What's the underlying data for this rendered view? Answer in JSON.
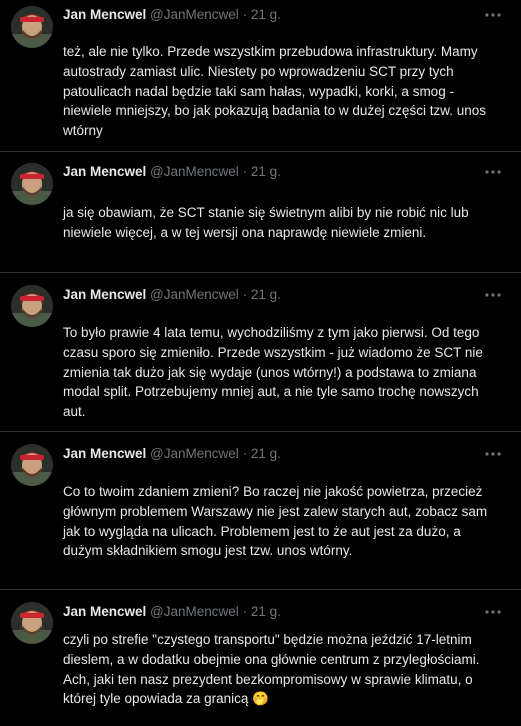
{
  "colors": {
    "background": "#000000",
    "text": "#e7e9ea",
    "muted": "#71767b",
    "divider": "#2f3336"
  },
  "icons": {
    "more": "more-horizontal-icon",
    "avatar": "profile-avatar"
  },
  "tweets": [
    {
      "name": "Jan Mencwel",
      "handle": "@JanMencwel",
      "separator": "·",
      "time": "21 g.",
      "text": "też, ale nie tylko. Przede wszystkim przebudowa infrastruktury. Mamy autostrady zamiast ulic. Niestety po wprowadzeniu SCT przy tych patoulicach nadal będzie taki sam hałas, wypadki, korki, a smog - niewiele mniejszy, bo jak pokazują badania to w dużej części tzw. unos wtórny"
    },
    {
      "name": "Jan Mencwel",
      "handle": "@JanMencwel",
      "separator": "·",
      "time": "21 g.",
      "text": "ja się obawiam, że SCT stanie się świetnym alibi by nie robić nic lub niewiele więcej, a w tej wersji ona naprawdę niewiele zmieni."
    },
    {
      "name": "Jan Mencwel",
      "handle": "@JanMencwel",
      "separator": "·",
      "time": "21 g.",
      "text": "To było prawie 4 lata temu, wychodziliśmy z tym jako pierwsi. Od tego czasu sporo się zmieniło. Przede wszystkim - już wiadomo że SCT nie zmienia tak dużo jak się wydaje (unos wtórny!) a podstawa to zmiana modal split. Potrzebujemy mniej aut, a nie tyle samo trochę nowszych aut."
    },
    {
      "name": "Jan Mencwel",
      "handle": "@JanMencwel",
      "separator": "·",
      "time": "21 g.",
      "text": "Co to twoim zdaniem zmieni? Bo raczej nie jakość powietrza, przecież głównym problemem Warszawy nie jest zalew starych aut, zobacz sam jak to wygląda na ulicach. Problemem jest to że aut jest za dużo, a dużym składnikiem smogu jest tzw. unos wtórny."
    },
    {
      "name": "Jan Mencwel",
      "handle": "@JanMencwel",
      "separator": "·",
      "time": "21 g.",
      "text": "czyli po strefie \"czystego transportu\" będzie można jeździć 17-letnim dieslem, a w dodatku obejmie ona głównie centrum z przyległościami. Ach, jaki ten nasz prezydent bezkompromisowy w sprawie klimatu, o której tyle opowiada za granicą 🤭"
    }
  ]
}
